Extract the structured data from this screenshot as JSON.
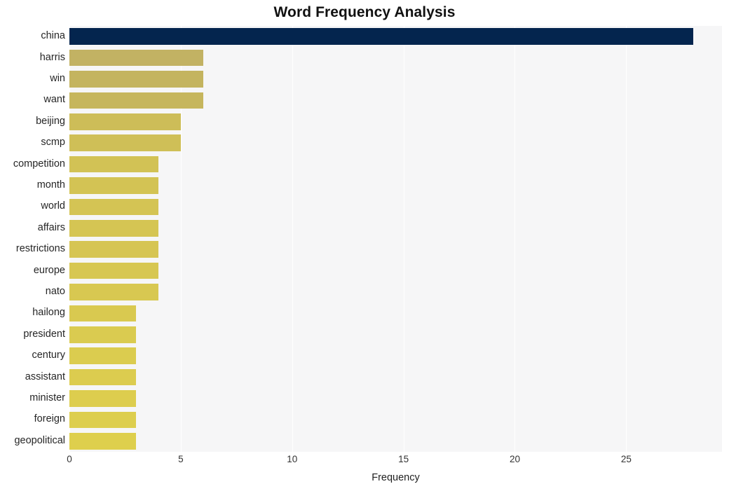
{
  "chart_data": {
    "type": "bar",
    "orientation": "horizontal",
    "title": "Word Frequency Analysis",
    "xlabel": "Frequency",
    "ylabel": "",
    "categories": [
      "china",
      "harris",
      "win",
      "want",
      "beijing",
      "scmp",
      "competition",
      "month",
      "world",
      "affairs",
      "restrictions",
      "europe",
      "nato",
      "hailong",
      "president",
      "century",
      "assistant",
      "minister",
      "foreign",
      "geopolitical"
    ],
    "values": [
      28,
      6,
      6,
      6,
      5,
      5,
      4,
      4,
      4,
      4,
      4,
      4,
      4,
      3,
      3,
      3,
      3,
      3,
      3,
      3
    ],
    "bar_colors": [
      "#04254e",
      "#c2b263",
      "#c4b45f",
      "#c6b65d",
      "#cdbd58",
      "#cfbf57",
      "#d2c255",
      "#d3c354",
      "#d4c454",
      "#d5c553",
      "#d6c553",
      "#d7c752",
      "#d8c851",
      "#d9c950",
      "#dacb50",
      "#dbcc4f",
      "#dccc4f",
      "#ddcd4e",
      "#ddce4e",
      "#decf4d"
    ],
    "xlim": [
      0,
      29.3
    ],
    "xticks": [
      0,
      5,
      10,
      15,
      20,
      25
    ],
    "xtick_labels": [
      "0",
      "5",
      "10",
      "15",
      "20",
      "25"
    ],
    "grid": true,
    "grid_axis": "x",
    "grid_color": "#ffffff",
    "plot_background": "#f6f6f7",
    "figure_background": "#ffffff",
    "legend": null
  }
}
